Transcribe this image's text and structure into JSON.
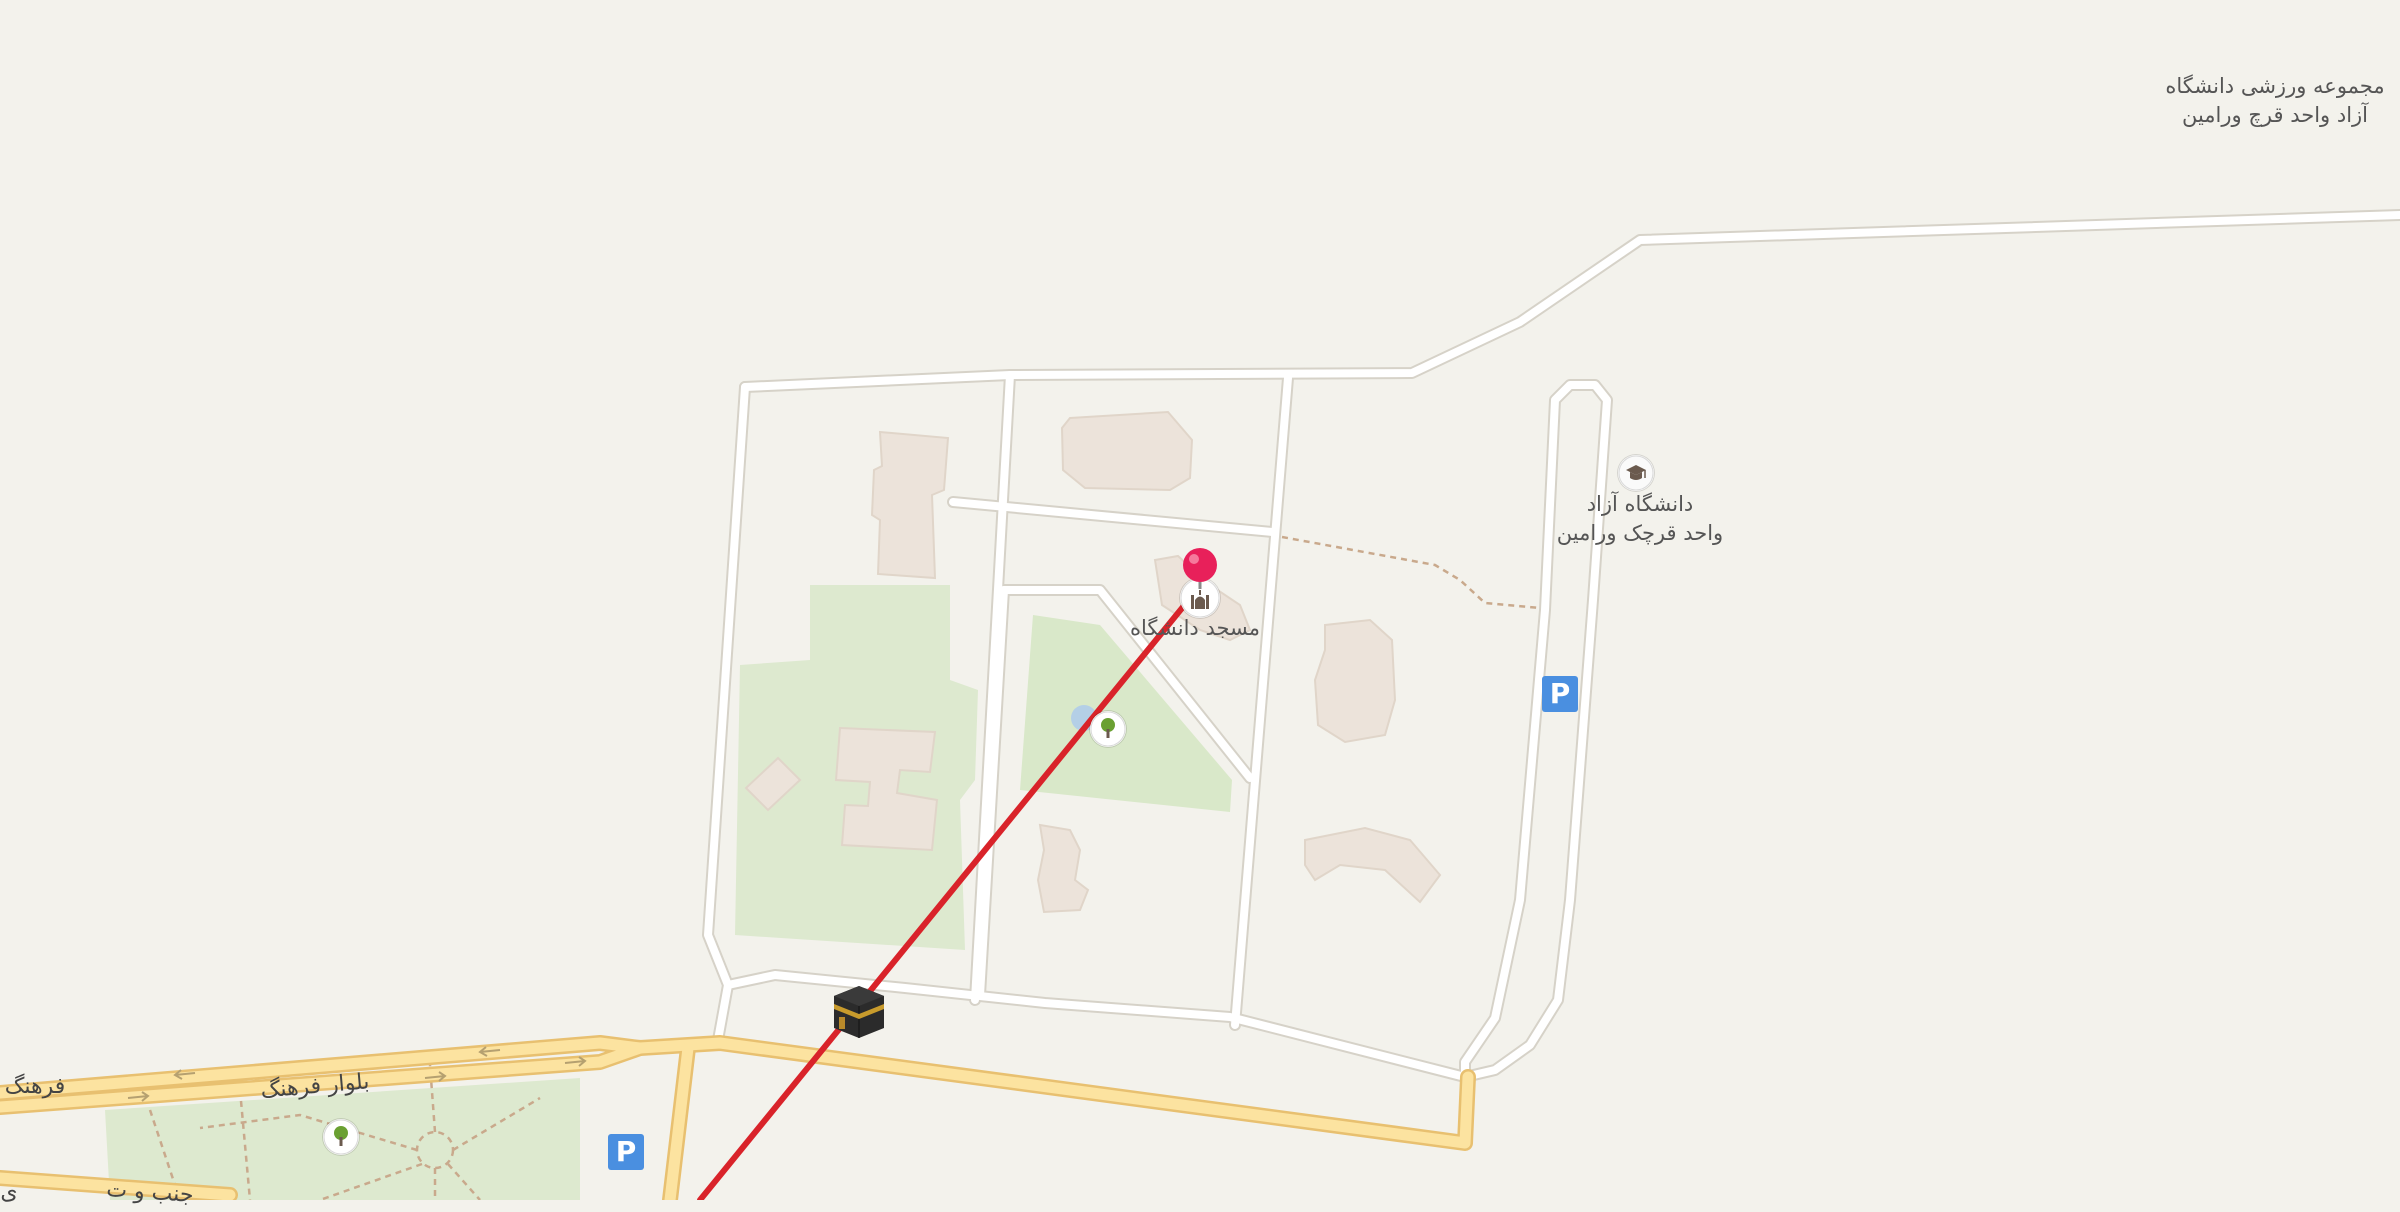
{
  "labels": {
    "university_complex": [
      "مجموعه ورزشی دانشگاه",
      "آزاد واحد قرچ ورامین"
    ],
    "university": [
      "دانشگاه آزاد",
      "واحد قرچک ورامین"
    ],
    "mosque": "مسجد دانشگاه",
    "road_left": "فرهنگ",
    "road_boulevard": "بلوار فرهنگ",
    "road_bottom": "جنب و ت",
    "road_edge": "ی"
  },
  "icons": {
    "destination_pin": "location-pin-icon",
    "mosque": "mosque-icon",
    "university": "graduation-cap-icon",
    "park_north": "tree-icon",
    "park_south": "tree-icon",
    "parking_east": "parking-icon",
    "parking_south": "parking-icon",
    "qibla_marker": "kaaba-icon"
  },
  "parking_letter": "P",
  "colors": {
    "background": "#f3f2ec",
    "minor_road": "#ffffff",
    "main_road": "#fce3a0",
    "main_road_casing": "#e8c070",
    "green_area": "#dde9cf",
    "building": "#ece3da",
    "footpath": "#c9a98c",
    "qibla_line": "#d9232a",
    "pin": "#e8205a",
    "parking": "#4a8fe0",
    "label_text": "#555555"
  }
}
